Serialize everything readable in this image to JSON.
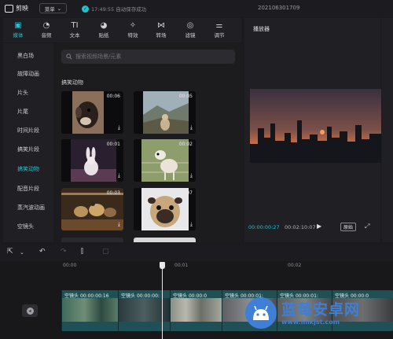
{
  "app": {
    "name": "剪映",
    "menu_label": "菜单",
    "save_status": "17:49:55 自动保存成功",
    "project_name": "202106301709"
  },
  "tools": [
    {
      "label": "媒体",
      "icon": "media-icon",
      "glyph": "▣",
      "active": true
    },
    {
      "label": "音频",
      "icon": "audio-icon",
      "glyph": "◔",
      "active": false
    },
    {
      "label": "文本",
      "icon": "text-icon",
      "glyph": "TI",
      "active": false
    },
    {
      "label": "贴纸",
      "icon": "sticker-icon",
      "glyph": "◕",
      "active": false
    },
    {
      "label": "特效",
      "icon": "effects-icon",
      "glyph": "✧",
      "active": false
    },
    {
      "label": "转场",
      "icon": "transition-icon",
      "glyph": "⋈",
      "active": false
    },
    {
      "label": "滤镜",
      "icon": "filter-icon",
      "glyph": "◎",
      "active": false
    },
    {
      "label": "调节",
      "icon": "adjust-icon",
      "glyph": "⚌",
      "active": false
    }
  ],
  "sidenav": [
    "黑白场",
    "故障动画",
    "片头",
    "片尾",
    "时间片段",
    "搞笑片段",
    "搞笑动物",
    "配音片段",
    "蒸汽波动画",
    "空镜头"
  ],
  "sidenav_active": "搞笑动物",
  "search": {
    "placeholder": "搜索视频场景/元素"
  },
  "section_title": "搞笑动物",
  "clips": [
    {
      "duration": "00:06",
      "subject": "dog"
    },
    {
      "duration": "00:05",
      "subject": "mountain-dog"
    },
    {
      "duration": "00:01",
      "subject": "rabbit"
    },
    {
      "duration": "00:02",
      "subject": "goat"
    },
    {
      "duration": "00:03",
      "subject": "ducks"
    },
    {
      "duration": "00:07",
      "subject": "pug"
    }
  ],
  "player": {
    "title": "播放器",
    "time_current": "00:00:00:27",
    "time_total": "00:02:10:07",
    "ratio_label": "原始"
  },
  "timeline": {
    "ruler": [
      "00:00",
      "00:01",
      "00:02"
    ],
    "clips": [
      {
        "label": "空镜头",
        "time": "00:00:00:16"
      },
      {
        "label": "空镜头",
        "time": "00:00:00:"
      },
      {
        "label": "空镜头",
        "time": "00:00:0"
      },
      {
        "label": "空镜头",
        "time": "00:00:01:"
      },
      {
        "label": "空镜头",
        "time": "00:00:01:"
      },
      {
        "label": "空镜头",
        "time": "00:00:0"
      }
    ]
  },
  "watermark": {
    "main": "蓝莓安卓网",
    "sub": "www.lmkjst.com"
  },
  "colors": {
    "accent": "#27bfd0",
    "bg": "#1b1b1f",
    "panel": "#202024",
    "track": "#1f5055",
    "watermark": "#3f7fd6"
  }
}
